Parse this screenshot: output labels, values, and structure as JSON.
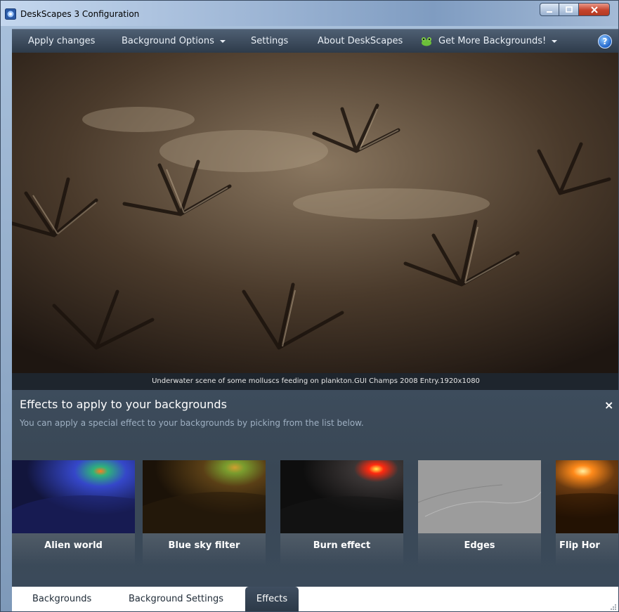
{
  "window": {
    "title": "DeskScapes 3 Configuration"
  },
  "menu": {
    "apply": "Apply changes",
    "background_options": "Background Options",
    "settings": "Settings",
    "about": "About DeskScapes",
    "get_more": "Get More Backgrounds!",
    "help": "?"
  },
  "preview": {
    "caption": "Underwater scene of some molluscs feeding on plankton.GUI Champs 2008 Entry.1920x1080"
  },
  "effects": {
    "title": "Effects to apply to your backgrounds",
    "subtitle": "You can apply a special effect to your backgrounds by picking from the list below.",
    "close": "×",
    "items": [
      {
        "label": "Alien world"
      },
      {
        "label": "Blue sky filter"
      },
      {
        "label": "Burn effect"
      },
      {
        "label": "Edges"
      },
      {
        "label": "Flip Hor"
      }
    ]
  },
  "tabs": {
    "backgrounds": "Backgrounds",
    "background_settings": "Background Settings",
    "effects": "Effects",
    "active": "Effects"
  },
  "colors": {
    "menubar": "#2e3b4a",
    "panel": "#3a4856",
    "accent_close": "#c5432c"
  }
}
